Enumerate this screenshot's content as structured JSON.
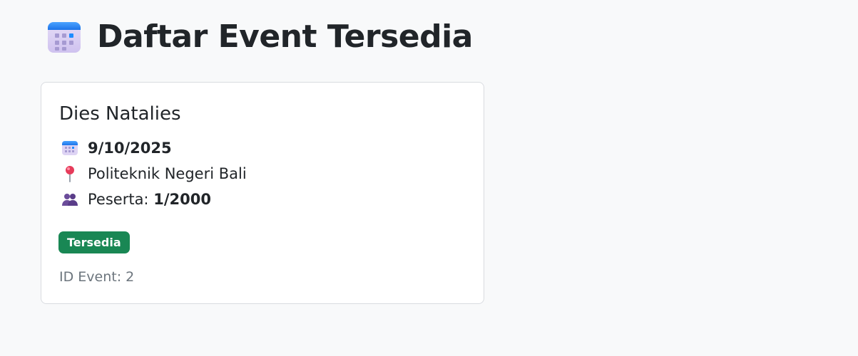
{
  "header": {
    "title": "Daftar Event Tersedia",
    "icon": "calendar-icon"
  },
  "events": [
    {
      "title": "Dies Natalies",
      "date": "9/10/2025",
      "location": "Politeknik Negeri Bali",
      "participants_label": "Peserta:",
      "participants_value": "1/2000",
      "status": "Tersedia",
      "status_color": "#198754",
      "event_id_label": "ID Event:",
      "event_id": "2",
      "icons": {
        "date": "calendar-icon",
        "location": "pushpin-icon",
        "participants": "people-icon"
      }
    }
  ],
  "colors": {
    "background": "#f8f9fa",
    "text": "#212529",
    "muted_text": "#6c757d",
    "card_border": "#d9dce0"
  }
}
